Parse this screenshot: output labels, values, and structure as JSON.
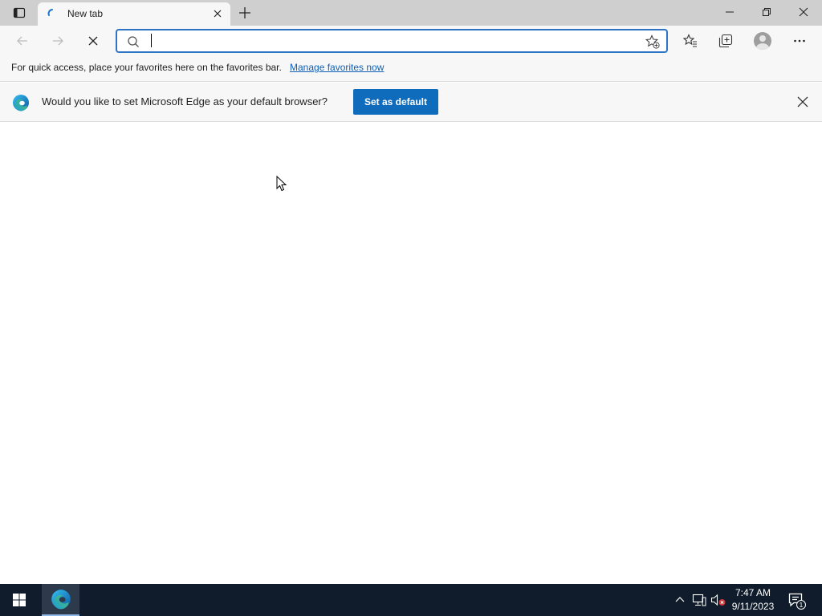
{
  "tab": {
    "title": "New tab",
    "favicon": "edge-loading-icon"
  },
  "window_controls": {
    "minimize": "minimize-icon",
    "restore": "restore-icon",
    "close": "close-icon"
  },
  "toolbar": {
    "address_value": "",
    "address_placeholder": ""
  },
  "favorites_bar": {
    "text": "For quick access, place your favorites here on the favorites bar.",
    "link": "Manage favorites now"
  },
  "infobar": {
    "message": "Would you like to set Microsoft Edge as your default browser?",
    "button_label": "Set as default"
  },
  "taskbar": {
    "time": "7:47 AM",
    "date": "9/11/2023",
    "notification_count": "1"
  },
  "colors": {
    "accent": "#0f6cbd",
    "taskbar": "#101c2b",
    "link": "#0f5fb5"
  }
}
